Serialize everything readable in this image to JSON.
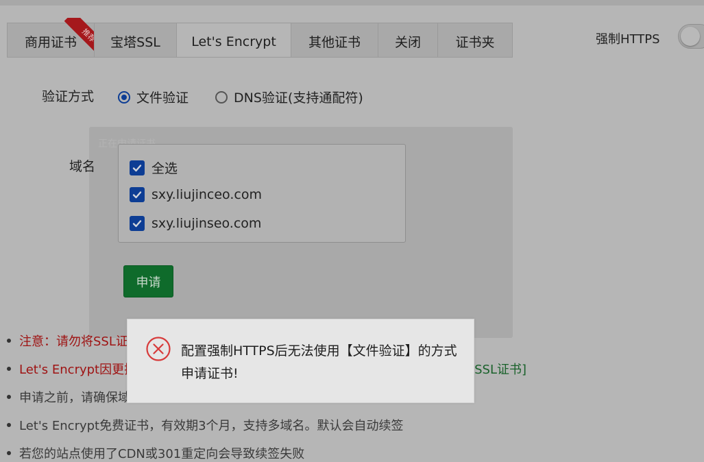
{
  "tabs": [
    {
      "label": "商用证书",
      "ribbon": "推荐"
    },
    {
      "label": "宝塔SSL"
    },
    {
      "label": "Let's Encrypt",
      "active": true
    },
    {
      "label": "其他证书"
    },
    {
      "label": "关闭"
    },
    {
      "label": "证书夹"
    }
  ],
  "https": {
    "label": "强制HTTPS",
    "enabled": false
  },
  "verify": {
    "label": "验证方式",
    "options": [
      {
        "label": "文件验证",
        "checked": true
      },
      {
        "label": "DNS验证(支持通配符)",
        "checked": false
      }
    ]
  },
  "loading_text": "正在申请证书...",
  "domain": {
    "label": "域名",
    "items": [
      {
        "label": "全选",
        "checked": true
      },
      {
        "label": "sxy.liujinceo.com",
        "checked": true
      },
      {
        "label": "sxy.liujinseo.com",
        "checked": true
      }
    ]
  },
  "apply_label": "申请",
  "notes": [
    {
      "text": "注意：请勿将SSL证书用于非法网站"
    },
    {
      "text": "Let's Encrypt因更换根证书，部分老旧设备访问时可能提示不可信，考虑购买",
      "link": "[商用SSL证书]"
    },
    {
      "text": "申请之前，请确保域名已解析，如未解析会导致审核失败"
    },
    {
      "text": "Let's Encrypt免费证书，有效期3个月，支持多域名。默认会自动续签"
    },
    {
      "text": "若您的站点使用了CDN或301重定向会导致续签失败"
    }
  ],
  "toast": {
    "icon": "error-circle-icon",
    "message": "配置强制HTTPS后无法使用【文件验证】的方式申请证书!"
  },
  "colors": {
    "accent": "#0d3d94",
    "button": "#0f6b2b",
    "warning_text": "#9e1212",
    "link_text": "#19612a"
  }
}
